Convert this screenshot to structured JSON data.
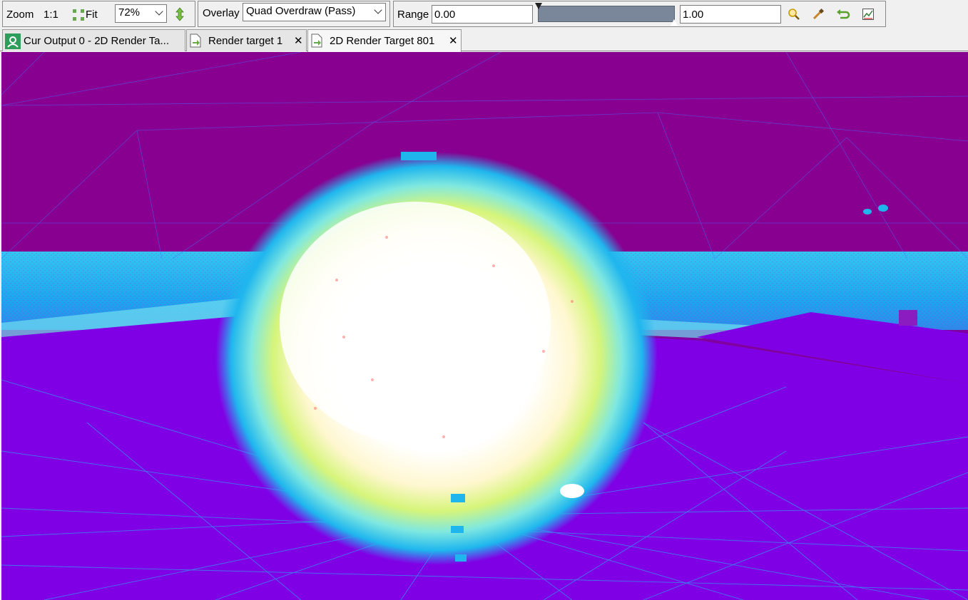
{
  "toolbar": {
    "zoom_label": "Zoom",
    "zoom_1to1": "1:1",
    "fit_label": "Fit",
    "zoom_value": "72%",
    "overlay_label": "Overlay",
    "overlay_value": "Quad Overdraw (Pass)",
    "range_label": "Range",
    "range_min": "0.00",
    "range_max": "1.00",
    "icons": [
      "fit-icon",
      "flip-icon",
      "zoom-range-icon",
      "picker-icon",
      "reset-icon",
      "histogram-icon"
    ]
  },
  "tabs": [
    {
      "label": "Cur Output 0 - 2D Render Ta...",
      "icon": "output-icon",
      "closable": false
    },
    {
      "label": "Render target 1",
      "icon": "texture-icon",
      "closable": true,
      "close": "✕"
    },
    {
      "label": "2D Render Target 801",
      "icon": "texture-icon",
      "closable": true,
      "close": "✕",
      "active": true
    }
  ],
  "viewport": {
    "sky_color": "#870090",
    "floor_color": "#8000e6",
    "wire_color": "#2aa8f0"
  }
}
